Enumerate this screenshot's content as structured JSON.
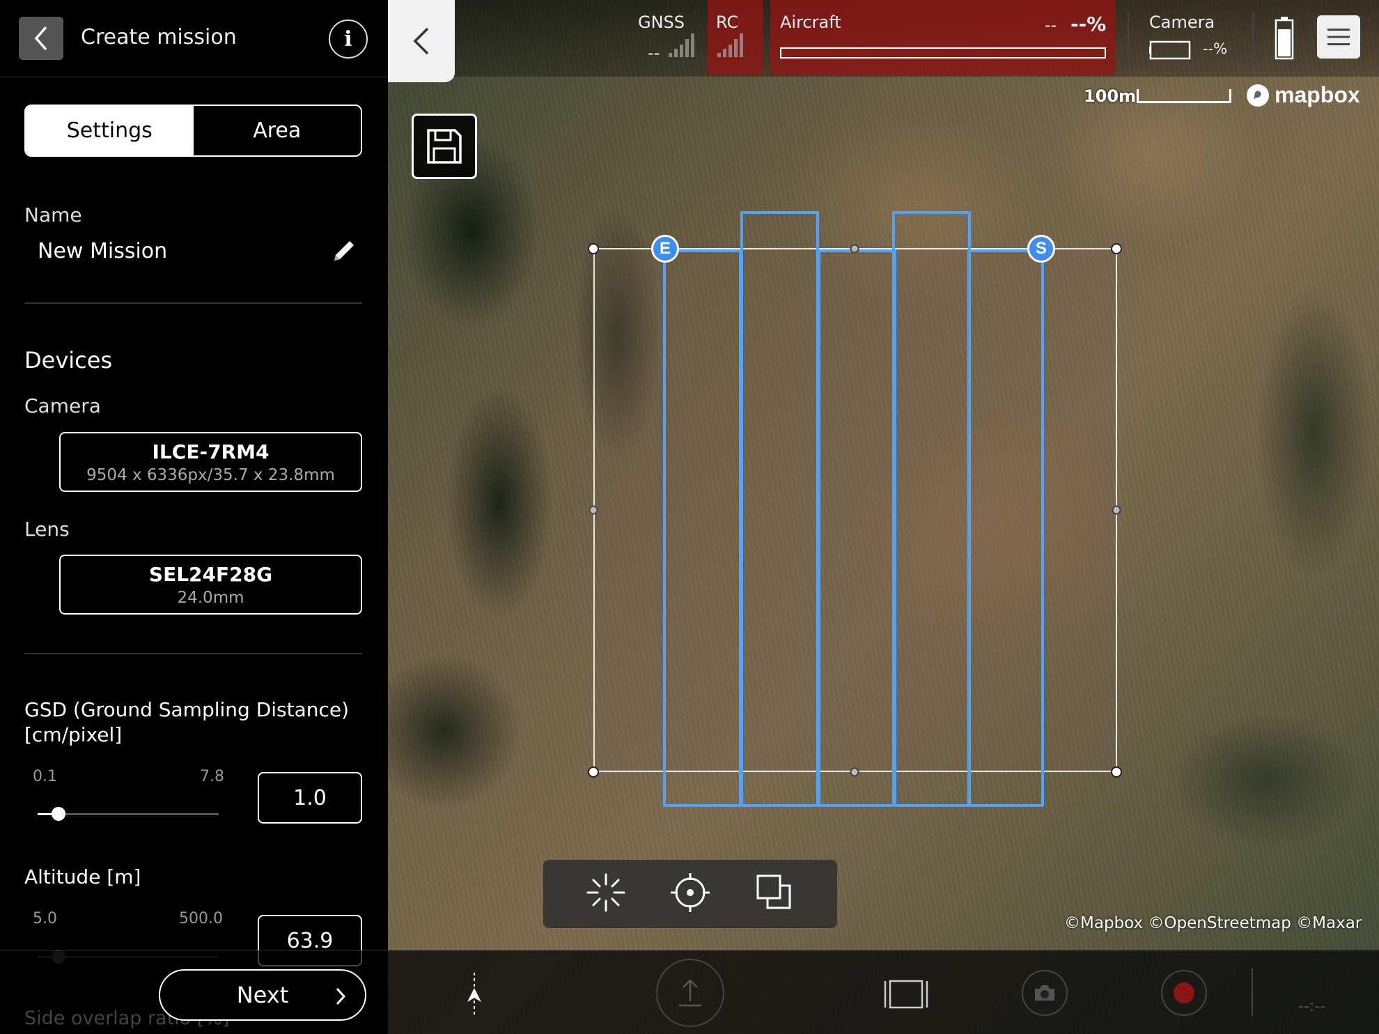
{
  "panel": {
    "title": "Create mission",
    "info_label": "i",
    "tabs": {
      "settings": "Settings",
      "area": "Area"
    },
    "name_label": "Name",
    "name_value": "New Mission",
    "devices_title": "Devices",
    "camera_label": "Camera",
    "camera_model": "ILCE-7RM4",
    "camera_spec": "9504 x 6336px/35.7 x 23.8mm",
    "lens_label": "Lens",
    "lens_model": "SEL24F28G",
    "lens_focal": "24.0mm",
    "gsd_label_line1": "GSD (Ground Sampling Distance)",
    "gsd_label_line2": "[cm/pixel]",
    "gsd_min": "0.1",
    "gsd_max": "7.8",
    "gsd_value": "1.0",
    "altitude_label": "Altitude [m]",
    "altitude_min": "5.0",
    "altitude_max": "500.0",
    "altitude_value": "63.9",
    "next_label": "Next",
    "side_overlap_label": "Side overlap ratio [%]"
  },
  "status": {
    "gnss_label": "GNSS",
    "gnss_value": "--",
    "rc_label": "RC",
    "aircraft_label": "Aircraft",
    "aircraft_dash": "--",
    "aircraft_pct": "--%",
    "camera_label": "Camera",
    "camera_pct": "--%"
  },
  "map": {
    "scale_label": "100m",
    "logo_text": "mapbox",
    "attribution": "©Mapbox ©OpenStreetmap ©Maxar",
    "waypoint_end": "E",
    "waypoint_start": "S",
    "lane_color": "#4da3ff",
    "alert_color": "#961414"
  },
  "bottom": {
    "time_placeholder": "--:--"
  }
}
